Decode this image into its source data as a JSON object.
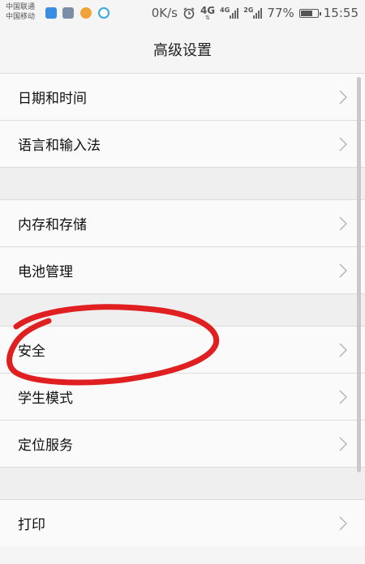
{
  "status_bar": {
    "carrier_1": "中国联通",
    "carrier_2": "中国移动",
    "speed": "0K/s",
    "network_1": "4G",
    "network_2": "4G",
    "network_3": "2G",
    "battery": "77%",
    "battery_level": 0.77,
    "time": "15:55",
    "icons": [
      "app-icon-blue",
      "gallery-icon",
      "weibo-icon",
      "browser-icon",
      "alarm-clock-icon"
    ]
  },
  "title": "高级设置",
  "groups": [
    [
      "日期和时间",
      "语言和输入法"
    ],
    [
      "内存和存储",
      "电池管理"
    ],
    [
      "安全",
      "学生模式",
      "定位服务"
    ],
    [
      "打印"
    ]
  ],
  "colors": {
    "annotation": "#e02020",
    "background": "#f5f5f5",
    "row": "#fafafa",
    "gap": "#efefef"
  }
}
